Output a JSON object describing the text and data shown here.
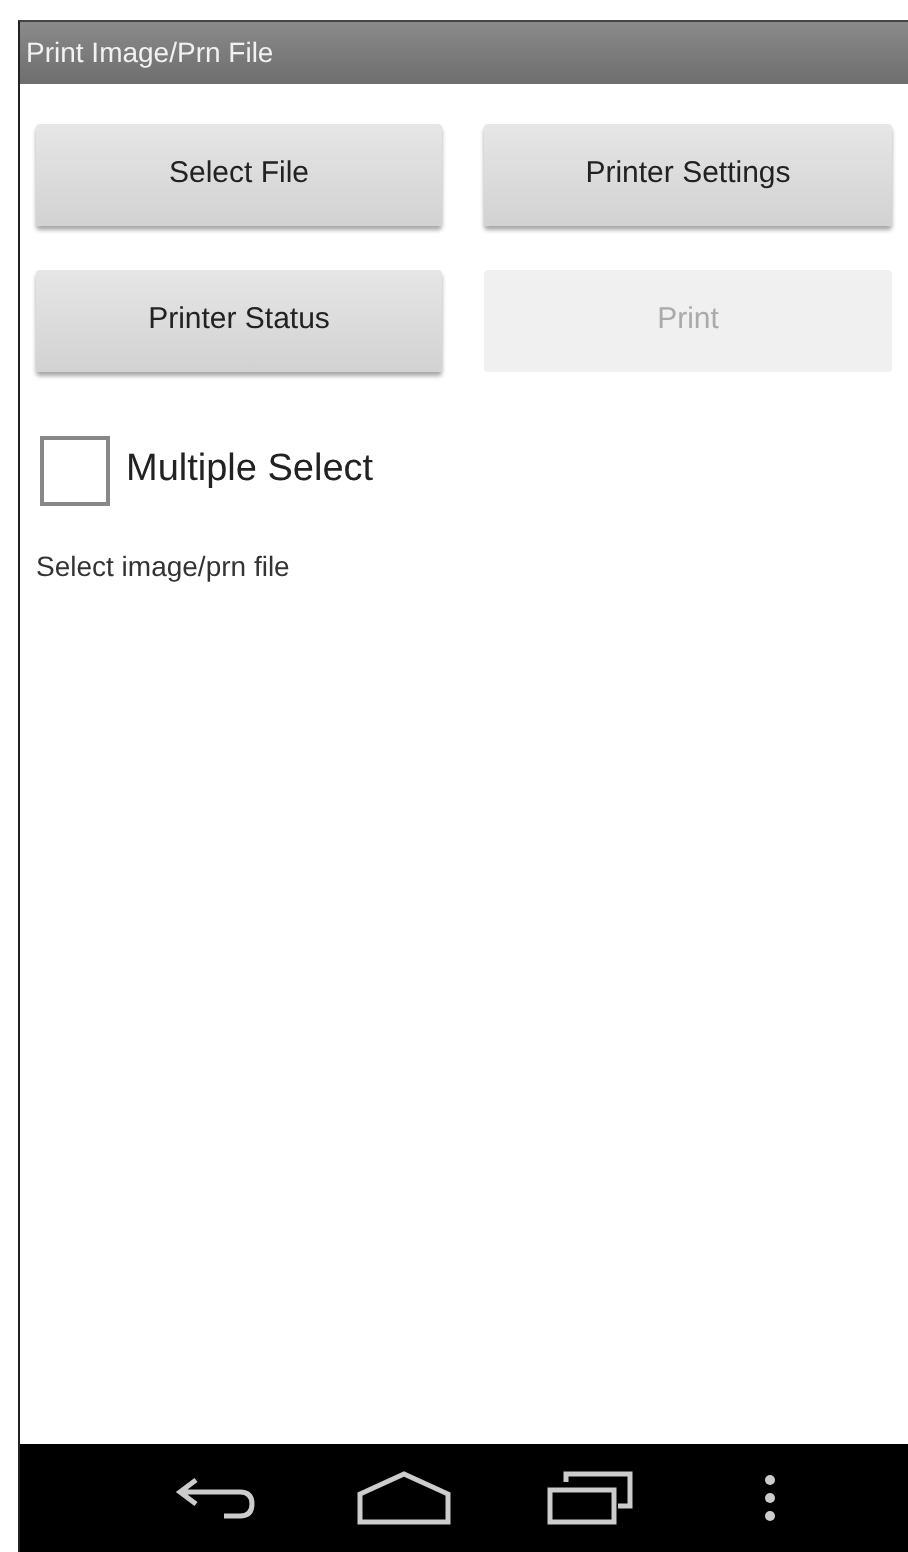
{
  "window": {
    "title": "Print Image/Prn File"
  },
  "buttons": [
    {
      "label": "Select File",
      "disabled": false
    },
    {
      "label": "Printer Settings",
      "disabled": false
    },
    {
      "label": "Printer Status",
      "disabled": false
    },
    {
      "label": "Print",
      "disabled": true
    }
  ],
  "checkbox": {
    "label": "Multiple Select",
    "checked": false
  },
  "status_text": "Select image/prn file",
  "nav_bar": {
    "buttons": [
      {
        "kind": "back"
      },
      {
        "kind": "home"
      },
      {
        "kind": "recents"
      },
      {
        "kind": "menu"
      }
    ]
  }
}
